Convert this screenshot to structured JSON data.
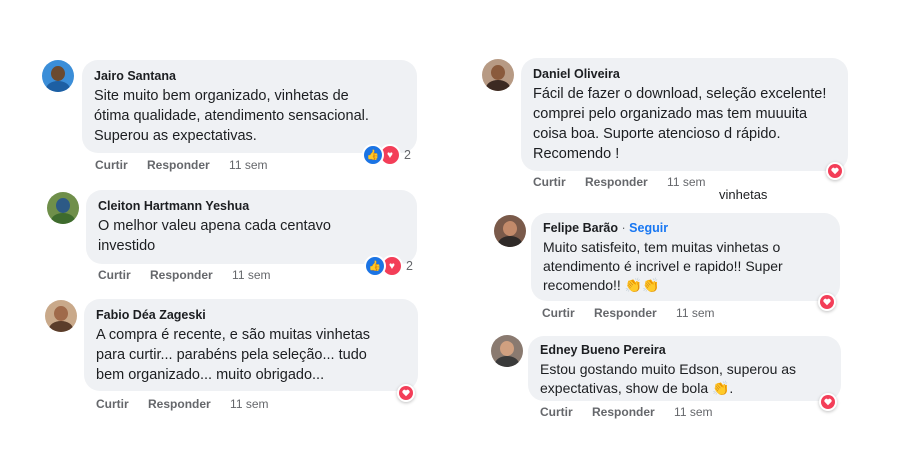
{
  "colors": {
    "bubble": "#eff1f4",
    "like": "#1b74e4",
    "love": "#f33e58",
    "link": "#1877f2",
    "meta": "#65676b"
  },
  "comments": [
    {
      "name": "Jairo Santana",
      "text": "Site muito bem organizado, vinhetas de\nótima qualidade, atendimento sensacional.\nSuperou as expectativas.",
      "like_label": "Curtir",
      "reply_label": "Responder",
      "time": "11 sem",
      "reactions": [
        "like-icon",
        "love-icon"
      ],
      "reaction_count": "2"
    },
    {
      "name": "Cleiton Hartmann Yeshua",
      "text": "O melhor valeu apena cada centavo\ninvestido",
      "like_label": "Curtir",
      "reply_label": "Responder",
      "time": "11 sem",
      "reactions": [
        "like-icon",
        "love-icon"
      ],
      "reaction_count": "2"
    },
    {
      "name": "Fabio Déa Zageski",
      "text": "A compra é recente, e são muitas vinhetas\npara curtir... parabéns pela seleção... tudo\nbem organizado... muito obrigado...",
      "like_label": "Curtir",
      "reply_label": "Responder",
      "time": "11 sem",
      "reactions": [
        "love-icon"
      ]
    },
    {
      "name": "Daniel Oliveira",
      "text": "Fácil de fazer o download, seleção excelente!\ncomprei pelo organizado mas tem muuuita\ncoisa boa. Suporte atencioso d rápido.\nRecomendo !",
      "like_label": "Curtir",
      "reply_label": "Responder",
      "time": "11 sem",
      "reactions": [
        "love-icon"
      ]
    },
    {
      "name": "Felipe Barão",
      "separator": "·",
      "follow_label": "Seguir",
      "text": "Muito satisfeito, tem muitas vinhetas o\natendimento é incrivel e rapido!! Super\nrecomendo!! 👏👏",
      "like_label": "Curtir",
      "reply_label": "Responder",
      "time": "11 sem",
      "reactions": [
        "love-icon"
      ]
    },
    {
      "name": "Edney Bueno Pereira",
      "text": "Estou gostando muito Edson, superou as\nexpectativas, show de bola 👏.",
      "like_label": "Curtir",
      "reply_label": "Responder",
      "time": "11 sem",
      "reactions": [
        "love-icon"
      ]
    }
  ],
  "stray_text": "vinhetas"
}
